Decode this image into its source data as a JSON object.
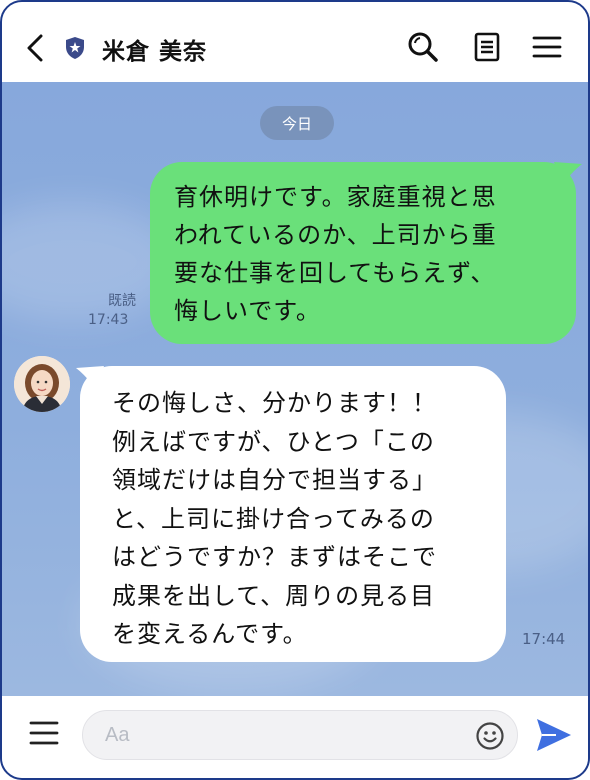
{
  "header": {
    "contact_name": "米倉 美奈",
    "icons": [
      "back-icon",
      "shield-icon",
      "search-icon",
      "notes-icon",
      "menu-icon"
    ]
  },
  "chat": {
    "date_label": "今日",
    "messages": [
      {
        "direction": "outgoing",
        "lines": [
          "育休明けです。家庭重視と思",
          "われているのか、上司から重",
          "要な仕事を回してもらえず、",
          "悔しいです。"
        ],
        "read_label": "既読",
        "time": "17:43"
      },
      {
        "direction": "incoming",
        "lines": [
          "その悔しさ、分かります！！",
          "例えばですが、ひとつ「この",
          "領域だけは自分で担当する」",
          "と、上司に掛け合ってみるの",
          "はどうですか？まずはそこで",
          "成果を出して、周りの見る目",
          "を変えるんです。"
        ],
        "time": "17:44"
      }
    ]
  },
  "footer": {
    "input_placeholder": "Aa",
    "icons": [
      "hamburger-icon",
      "emoji-icon",
      "send-icon"
    ]
  },
  "colors": {
    "frame_border": "#1d3a8a",
    "chat_background": "#8aa9d8",
    "outgoing_bubble": "#6ae07a",
    "incoming_bubble": "#ffffff",
    "send_icon": "#3f6fe0"
  }
}
